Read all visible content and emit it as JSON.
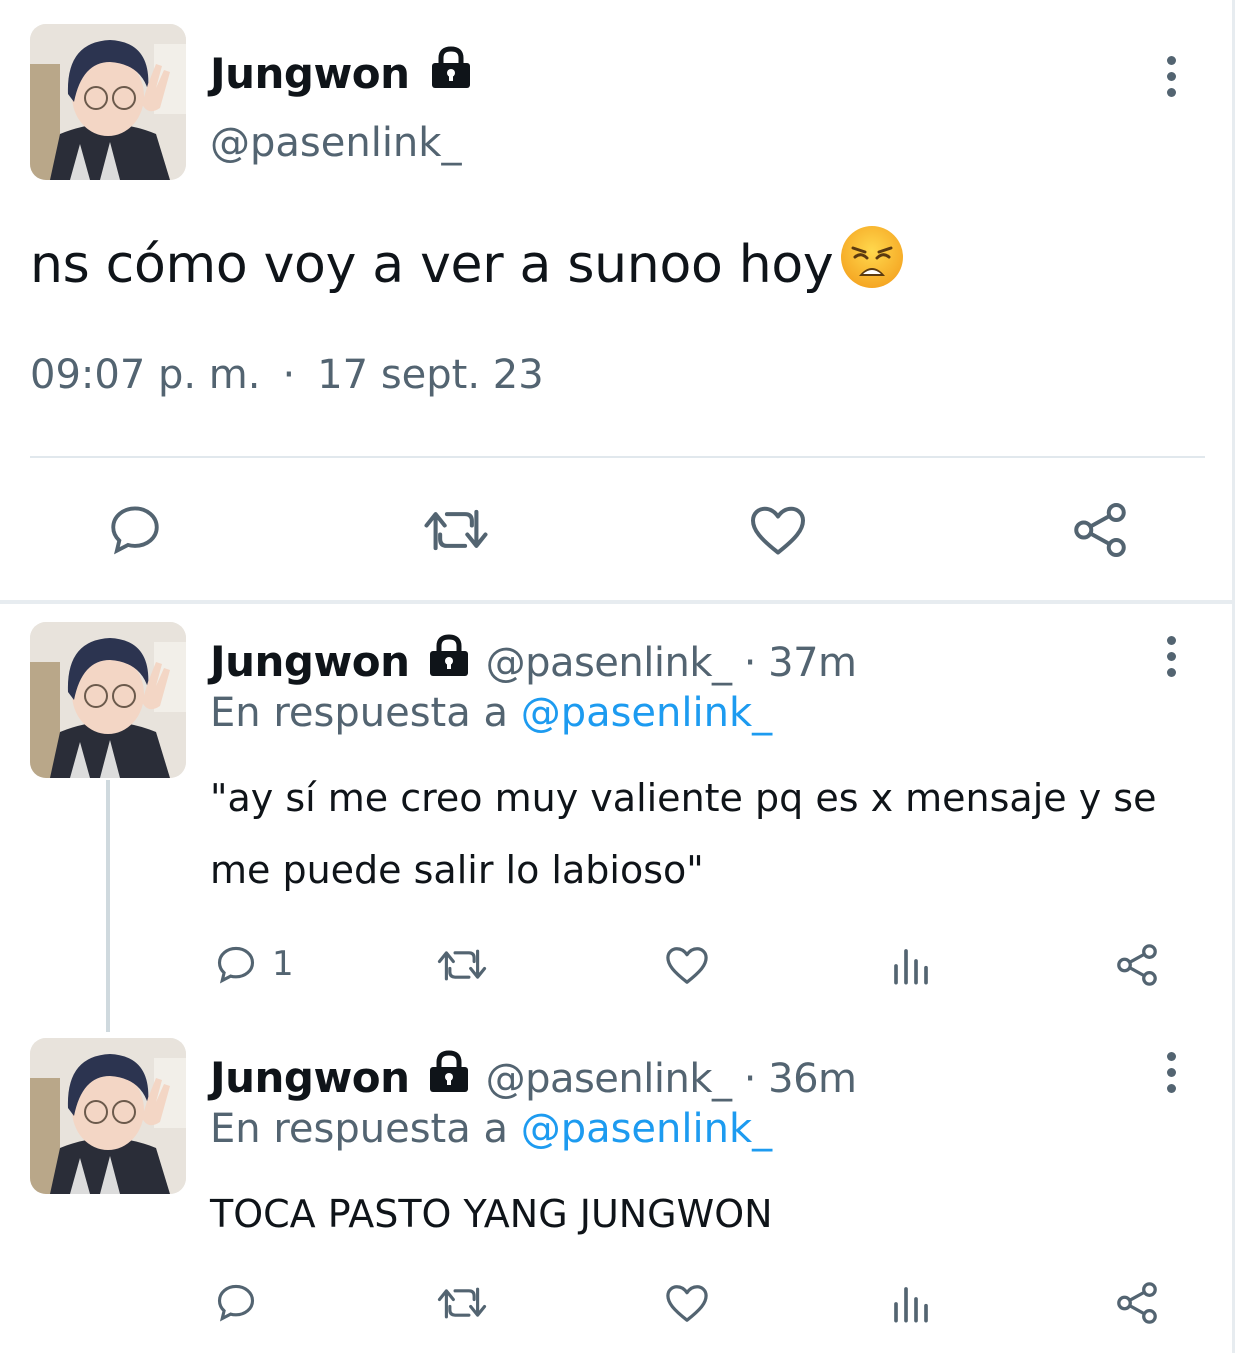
{
  "main_tweet": {
    "display_name": "Jungwon",
    "handle": "@pasenlink_",
    "text": "ns cómo voy a ver a sunoo hoy",
    "time": "09:07 p. m.",
    "separator": "·",
    "date": "17 sept. 23",
    "icons": [
      "lock-icon",
      "more-icon",
      "weary-face-emoji",
      "reply-icon",
      "retweet-icon",
      "like-icon",
      "share-icon"
    ]
  },
  "replies": [
    {
      "display_name": "Jungwon",
      "handle_time": "@pasenlink_ · 37m",
      "replying_prefix": "En respuesta a",
      "replying_to": "@pasenlink_",
      "text": "\"ay sí me creo muy valiente pq es x mensaje y se me puede salir lo labioso\"",
      "reply_count": "1"
    },
    {
      "display_name": "Jungwon",
      "handle_time": "@pasenlink_ · 36m",
      "replying_prefix": "En respuesta a",
      "replying_to": "@pasenlink_",
      "text": "TOCA PASTO YANG JUNGWON",
      "reply_count": ""
    }
  ],
  "colors": {
    "text": "#0f1419",
    "secondary": "#536471",
    "link": "#1d9bf0",
    "divider": "#e1e8ed"
  }
}
